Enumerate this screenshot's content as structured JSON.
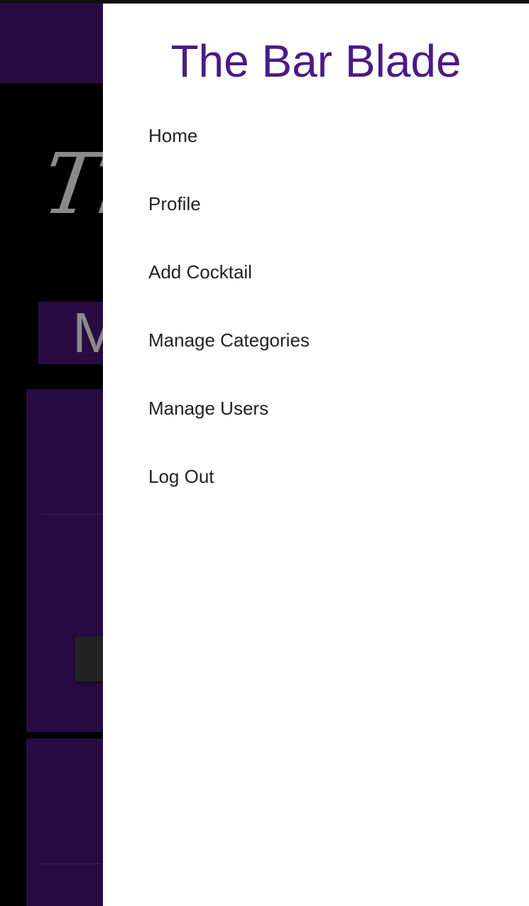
{
  "drawer": {
    "brand": "The Bar Blade",
    "items": [
      {
        "label": "Home"
      },
      {
        "label": "Profile"
      },
      {
        "label": "Add Cocktail"
      },
      {
        "label": "Manage Categories"
      },
      {
        "label": "Manage Users"
      },
      {
        "label": "Log Out"
      }
    ]
  },
  "background_page": {
    "hero_title_visible": "Th",
    "section_heading_visible": "M"
  },
  "colors": {
    "brand_purple": "#4b1a86",
    "header_bg": "#2a0b44",
    "card_bg": "#280b42",
    "drawer_bg": "#ffffff",
    "page_bg": "#000000"
  }
}
